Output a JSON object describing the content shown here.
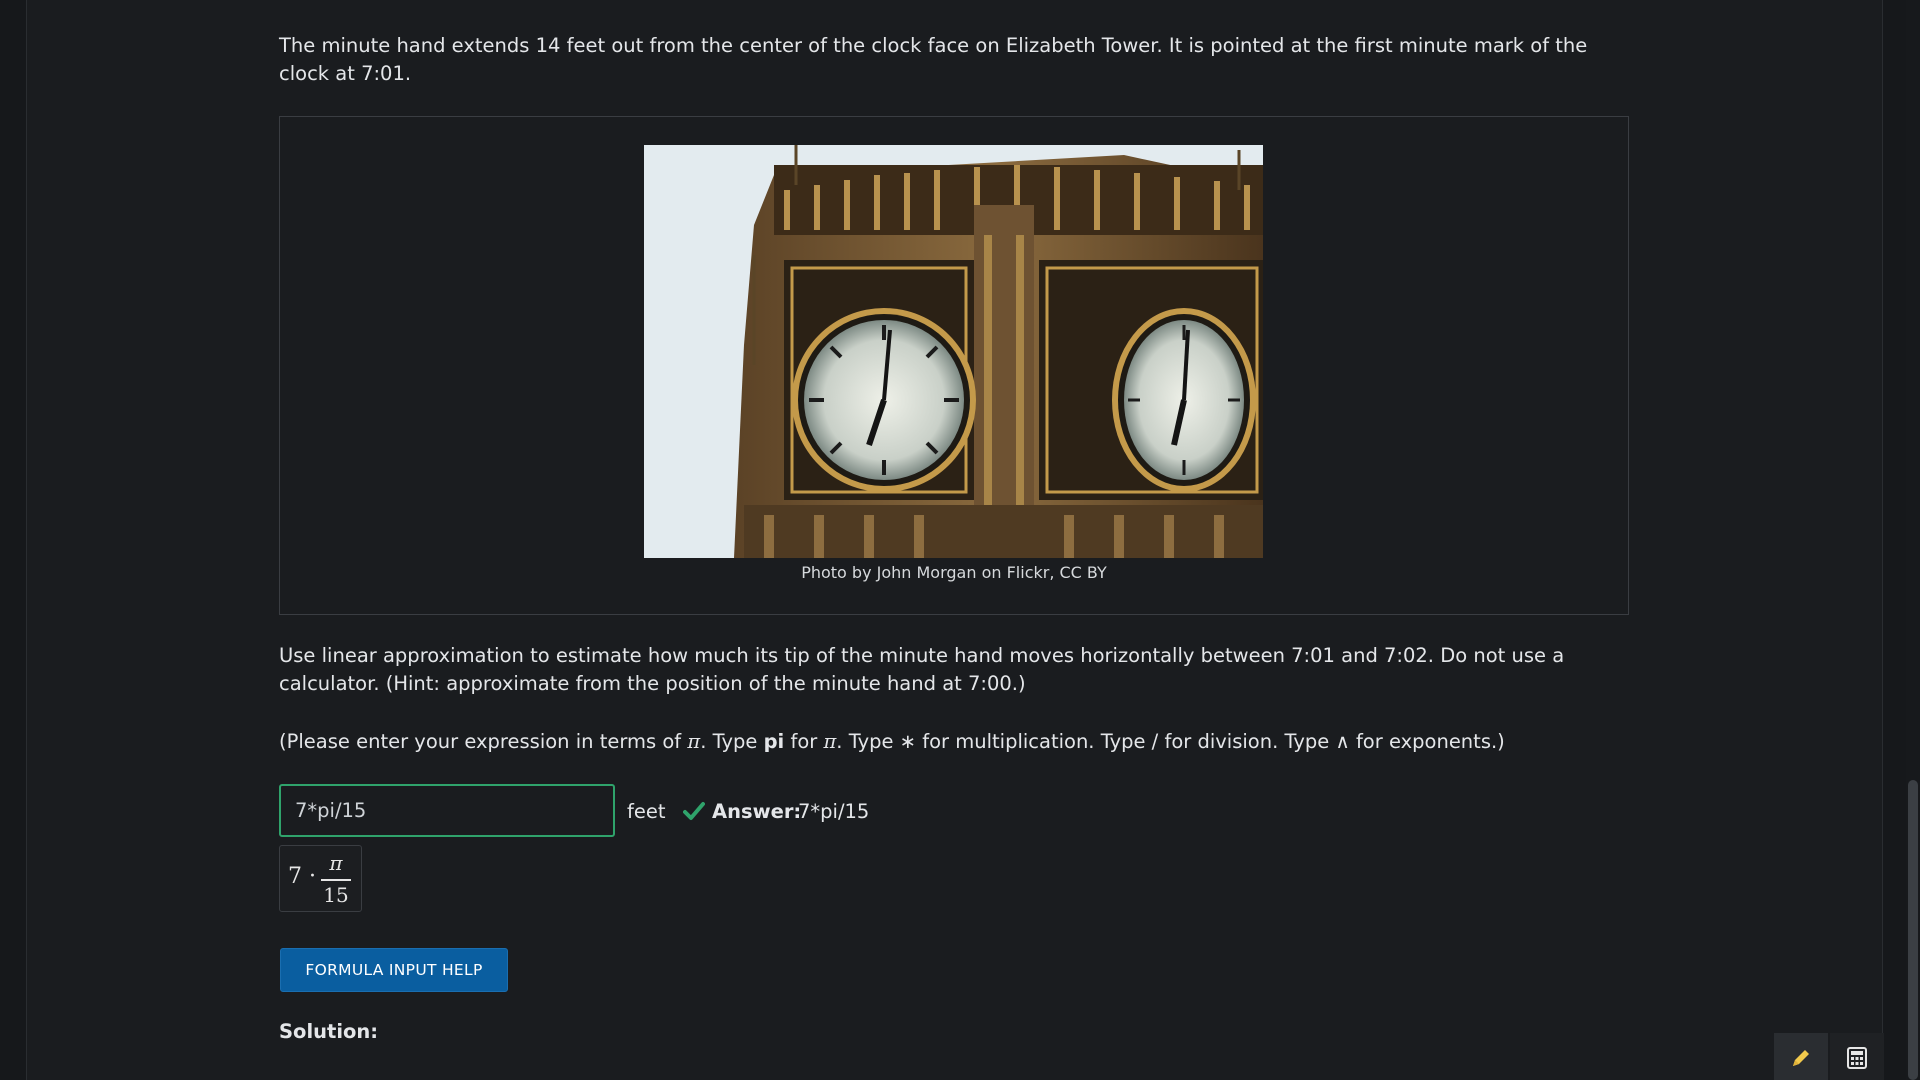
{
  "problem": {
    "paragraph1": "The minute hand extends 14 feet out from the center of the clock face on Elizabeth Tower. It is pointed at the first minute mark of the clock at 7:01.",
    "image_alt": "Elizabeth Tower clock faces",
    "caption": "Photo by John Morgan on Flickr, CC BY",
    "paragraph2": "Use linear approximation to estimate how much its tip of the minute hand moves horizontally between 7:01 and 7:02. Do not use a calculator. (Hint: approximate from the position of the minute hand at 7:00.)",
    "paragraph3_prefix": "(Please enter your expression in terms of ",
    "pi_symbol": "π",
    "paragraph3_mid1": ". Type ",
    "pi_word": "pi",
    "paragraph3_mid2": " for ",
    "paragraph3_rest": ". Type ∗ for multiplication. Type / for division. Type ∧ for exponents.)"
  },
  "answer": {
    "input_value": "7*pi/15",
    "unit": "feet",
    "label": "Answer:",
    "value": "7*pi/15",
    "preview_coeff": "7 ·",
    "preview_num": "π",
    "preview_den": "15"
  },
  "buttons": {
    "formula_help": "FORMULA INPUT HELP"
  },
  "solution": {
    "heading": "Solution:"
  },
  "colors": {
    "accent_green": "#2fa36b",
    "button_blue": "#0a5ea0",
    "background": "#1a1c1f"
  }
}
